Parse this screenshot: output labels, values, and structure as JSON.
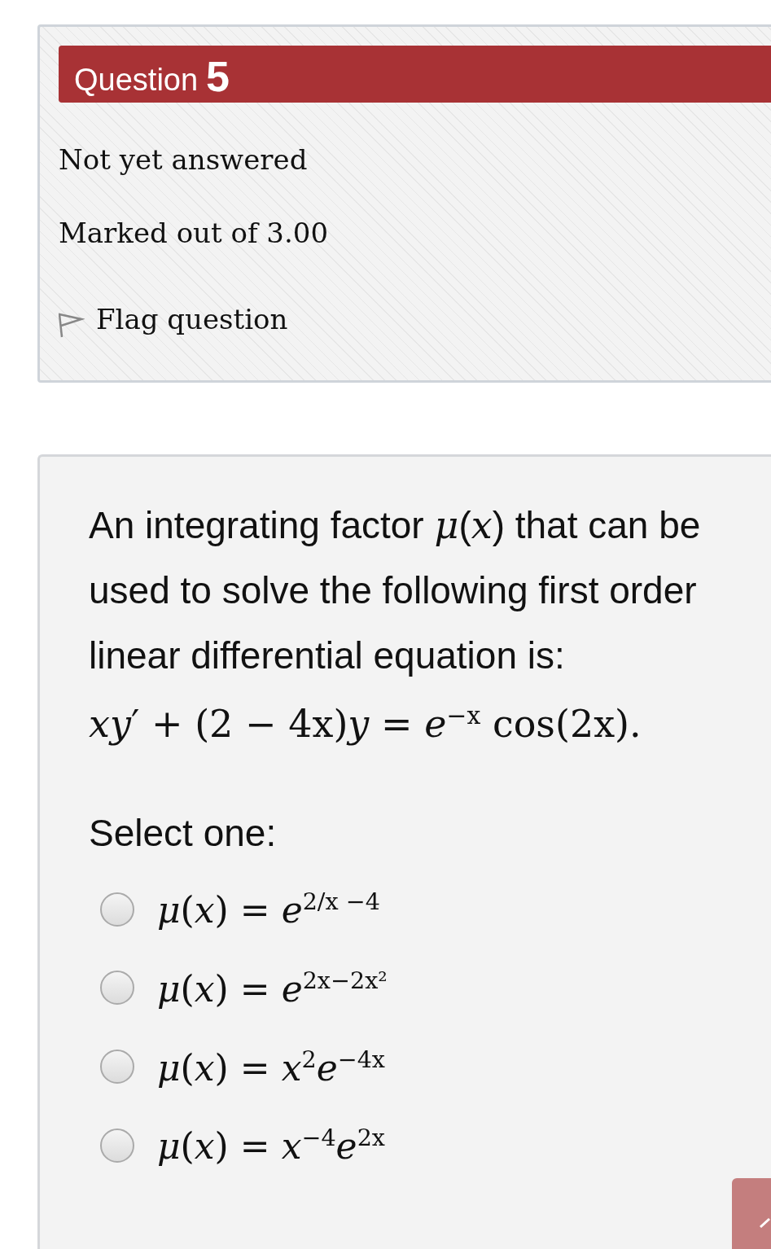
{
  "info": {
    "question_label": "Question",
    "question_number": "5",
    "status": "Not yet answered",
    "marks": "Marked out of 3.00",
    "flag": {
      "label": "Flag question",
      "flagged": false
    }
  },
  "question": {
    "text": "An integrating factor *μ*(*x*) that can be used to solve the following first order linear differential equation is:",
    "equation": "*xy*′ + (2 − 4x)*y* = *e*$^{−x}$ cos(2x).",
    "prompt": "Select one:",
    "options": [
      {
        "formula": "*μ*(*x*) = *e*$^{2/x −4}$",
        "selected": false
      },
      {
        "formula": "*μ*(*x*) = *e*$^{2x−2x²}$",
        "selected": false
      },
      {
        "formula": "*μ*(*x*) = *x*$^{2}$*e*$^{−4x}$",
        "selected": false
      },
      {
        "formula": "*μ*(*x*) = *x*$^{−4}$*e*$^{2x}$",
        "selected": false
      }
    ]
  }
}
